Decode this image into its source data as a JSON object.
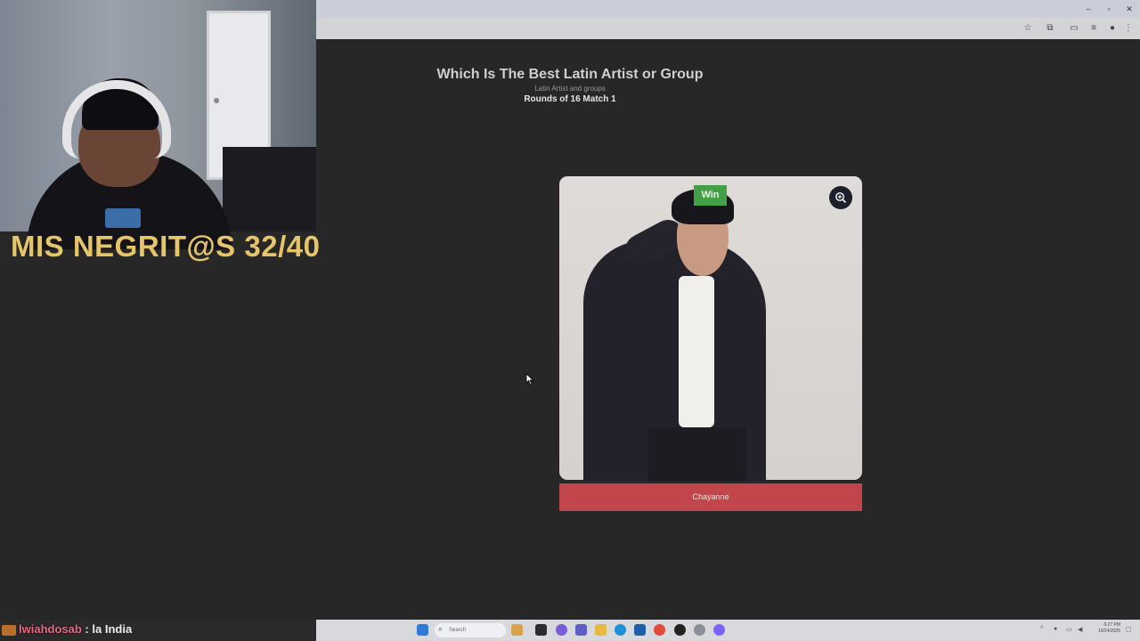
{
  "webcam": {
    "caption": "MIS NEGRIT@S 32/40"
  },
  "page": {
    "title": "Which Is The Best Latin Artist or Group",
    "subtitle": "Latin Artist and groups",
    "round": "Rounds of 16 Match 1"
  },
  "card": {
    "badge": "Win",
    "name": "Chayanne",
    "zoom_icon": "zoom-in-icon"
  },
  "chat": {
    "user": "lwiahdosab",
    "separator": ":",
    "message": "la India"
  },
  "taskbar": {
    "search_placeholder": "Search",
    "time": "6:27 PM",
    "date": "10/24/2025"
  },
  "colors": {
    "background": "#272727",
    "win_badge": "#43a047",
    "name_bar": "#c0464b",
    "caption": "#e5c46a"
  }
}
